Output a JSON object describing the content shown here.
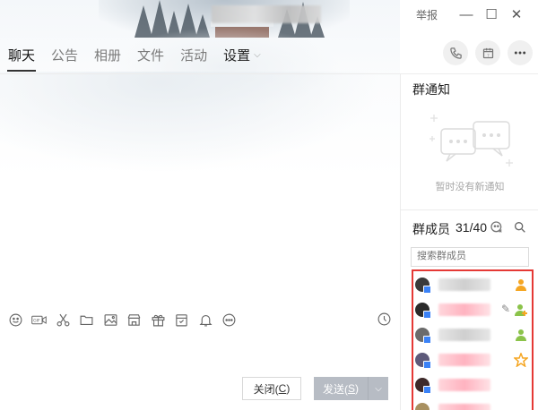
{
  "window": {
    "report_label": "举报",
    "minimize_glyph": "—",
    "maximize_glyph": "☐",
    "close_glyph": "✕"
  },
  "tabs": [
    {
      "label": "聊天",
      "active": true
    },
    {
      "label": "公告",
      "active": false
    },
    {
      "label": "相册",
      "active": false
    },
    {
      "label": "文件",
      "active": false
    },
    {
      "label": "活动",
      "active": false
    },
    {
      "label": "设置",
      "active": false,
      "dropdown": true
    }
  ],
  "top_actions": [
    "phone-icon",
    "calendar-icon",
    "more-icon"
  ],
  "notice": {
    "title": "群通知",
    "empty_text": "暂时没有新通知"
  },
  "members": {
    "title": "群成员",
    "count": "31/40",
    "search_placeholder": "搜索群成员",
    "list": [
      {
        "avatar_color": "#3a3a3a",
        "name_style": "gray",
        "badge": "person-orange"
      },
      {
        "avatar_color": "#2b2b2b",
        "name_style": "pink",
        "badge": "person-green-add",
        "editable": true
      },
      {
        "avatar_color": "#6b6b6b",
        "name_style": "gray",
        "badge": "person-green"
      },
      {
        "avatar_color": "#5d5a7a",
        "name_style": "pink",
        "badge": "star"
      },
      {
        "avatar_color": "#3e2a2a",
        "name_style": "pink",
        "badge": ""
      },
      {
        "avatar_color": "#a89060",
        "name_style": "pink",
        "badge": ""
      }
    ]
  },
  "toolbar": [
    "emoji-icon",
    "gif-icon",
    "scissors-icon",
    "folder-icon",
    "image-icon",
    "shop-icon",
    "gift-icon",
    "calendar-mini-icon",
    "bell-icon",
    "more-circle-icon"
  ],
  "buttons": {
    "close_label": "关闭(",
    "close_key": "C",
    "close_suffix": ")",
    "send_label": "发送(",
    "send_key": "S",
    "send_suffix": ")",
    "send_arrow": "⌵"
  },
  "colors": {
    "highlight_border": "#e53935",
    "send_button": "#b7bcc4"
  }
}
